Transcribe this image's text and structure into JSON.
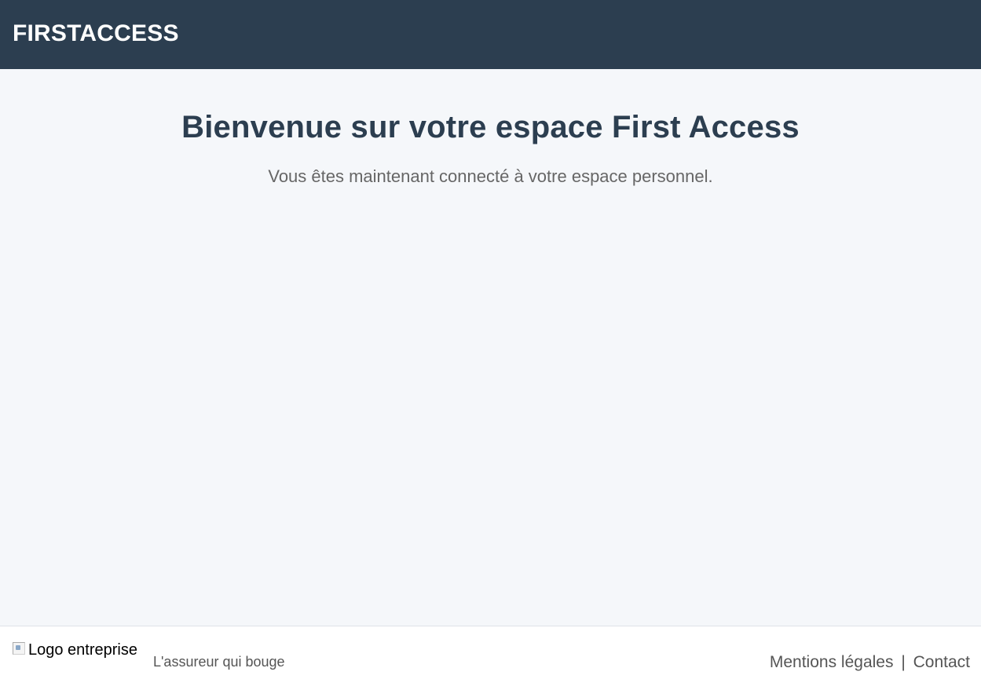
{
  "header": {
    "brand": "FIRSTACCESS",
    "background_color": "#2c3e50"
  },
  "main": {
    "title": "Bienvenue sur votre espace First Access",
    "subtitle": "Vous êtes maintenant connecté à votre espace personnel."
  },
  "footer": {
    "logo_alt": "Logo entreprise",
    "logo_icon": "broken-image-icon",
    "tagline": "L'assureur qui bouge",
    "links": {
      "legal": "Mentions légales",
      "separator": "|",
      "contact": "Contact"
    }
  }
}
